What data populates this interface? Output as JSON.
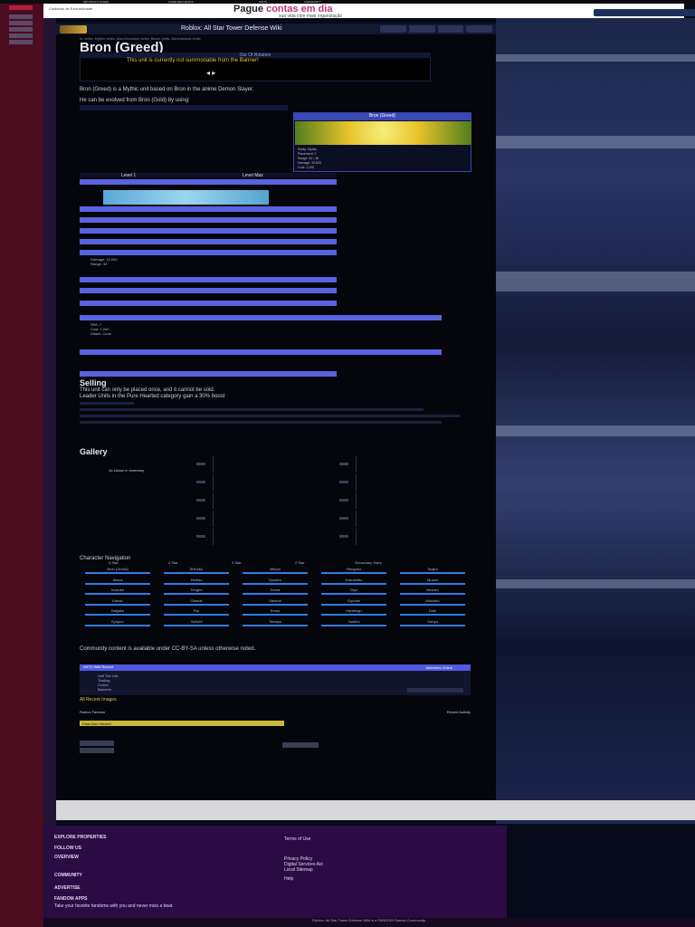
{
  "top_nav": {
    "items": [
      "IMPORTANT PAGES",
      "GAME MECHANICS",
      "UNITS",
      "COMMUNITY"
    ]
  },
  "ad": {
    "title": "Pague",
    "title_accent": "contas em dia",
    "subtitle": "sua vida com mais organização",
    "left_text": "Cuidando de Exclusividade"
  },
  "header": {
    "site_name": "Roblox: All Star Tower Defense Wiki"
  },
  "page": {
    "title": "Bron (Greed)",
    "breadcrumb": "in: Units, Mythic Units, Non-Exclusive Units, Blade Units, Dimensional Units",
    "media_banner": "Out Of Rotation",
    "media_caption": "This unit is currently not summonable from the Banner!",
    "intro_1": "Bron (Greed) is a Mythic unit based on Bron in the anime Demon Slayer.",
    "intro_2": "He can be evolved from Bron (Gold) by using:"
  },
  "infobox": {
    "title": "Bron (Greed)",
    "rows": [
      "Rarity: Mythic",
      "Placement: 3",
      "Range: 34 / 45",
      "Damage: 25,500",
      "Cost: 1,200"
    ]
  },
  "levels": {
    "head_left": "Level 1",
    "head_right": "Level Max",
    "sub_rows": [
      "Damage: 16,000",
      "Range: 34",
      "SPA: 7",
      "Cost: 1,200",
      "Attack: Cone"
    ]
  },
  "selling": {
    "title": "Selling",
    "text": "This unit can only be placed once, and it cannot be sold.",
    "text2": "Leader Units in the Pure Hearted category gain a 30% boost"
  },
  "gallery": {
    "title": "Gallery",
    "caption": "As shown in Inventory"
  },
  "character_nav": {
    "title": "Character Navigation",
    "tabs": [
      "5 Star",
      "4 Star",
      "3 Star",
      "2 Star",
      "Secondary Stars"
    ],
    "cells": [
      "Bron (Greed)",
      "Shinobu",
      "Mitsuri",
      "Rengoku",
      "Tanjiro",
      "Akaza",
      "Zenitsu",
      "Gyutaro",
      "Kokushibo",
      "Muzan",
      "Inosuke",
      "Tengen",
      "Doma",
      "Giyu",
      "Nezuko",
      "Kanao",
      "Obanai",
      "Sanemi",
      "Gyomei",
      "Muichiro",
      "Kaigaku",
      "Rui",
      "Enmu",
      "Hantengu",
      "Daki",
      "Kyojuro",
      "Yoriichi",
      "Tamayo",
      "Yushiro",
      "Genya"
    ]
  },
  "license": "Community content is available under CC-BY-SA unless otherwise noted.",
  "recent": {
    "header": "ASTD Wiki Recent",
    "right": "Members Online",
    "items": [
      "Unit Tier List",
      "Trading",
      "Codes",
      "Banners"
    ]
  },
  "footer_section": "All Recent Images",
  "fandom_mini": {
    "left": "Roblox Fandom",
    "right": "Recent Activity",
    "subtitle": "Fans Also Viewed"
  },
  "bottom_footer": {
    "explore": "EXPLORE PROPERTIES",
    "follow": "FOLLOW US",
    "overview": "OVERVIEW",
    "community": "COMMUNITY",
    "advertise": "ADVERTISE",
    "apps": "FANDOM APPS",
    "apps_tag": "Take your favorite fandoms with you and never miss a beat.",
    "right_col": [
      "Terms of Use",
      "Privacy Policy",
      "Digital Services Act",
      "Local Sitemap",
      "Help"
    ],
    "bar_text": "Roblox: All Star Tower Defense Wiki is a FANDOM Games Community."
  }
}
